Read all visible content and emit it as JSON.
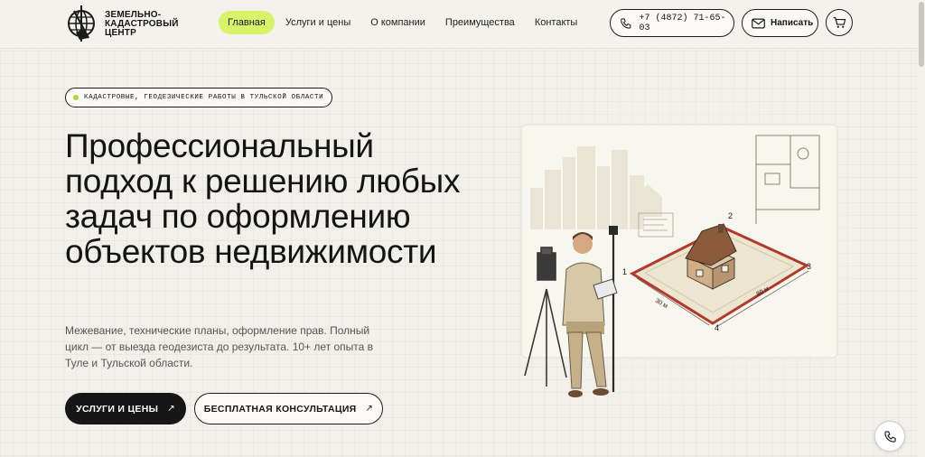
{
  "logo": {
    "lines": [
      "ЗЕМЕЛЬНО-",
      "КАДАСТРОВЫЙ",
      "ЦЕНТР"
    ]
  },
  "nav": [
    {
      "label": "Главная",
      "active": true
    },
    {
      "label": "Услуги и цены",
      "active": false
    },
    {
      "label": "О компании",
      "active": false
    },
    {
      "label": "Преимущества",
      "active": false
    },
    {
      "label": "Контакты",
      "active": false
    }
  ],
  "header": {
    "phone": "+7 (4872) 71-65-03",
    "write_label": "Написать",
    "icons": {
      "phone": "phone-icon",
      "write": "mail-icon",
      "cart": "cart-icon"
    }
  },
  "hero": {
    "badge": "КАДАСТРОВЫЕ, ГЕОДЕЗИЧЕСКИЕ РАБОТЫ В ТУЛЬСКОЙ ОБЛАСТИ",
    "title": "Профессиональный подход к решению любых задач по оформлению объектов недвижимости",
    "description": "Межевание, технические планы, оформление прав. Полный цикл — от выезда геодезиста до результата. 10+ лет опыта в Туле и Тульской области.",
    "primary_button": "УСЛУГИ И ЦЕНЫ",
    "secondary_button": "БЕСПЛАТНАЯ КОНСУЛЬТАЦИЯ",
    "button_arrow": "↗",
    "illustration_labels": {
      "p1": "1",
      "p2": "2",
      "p3": "3",
      "p4": "4",
      "d1": "30 м",
      "d2": "80 м"
    }
  },
  "colors": {
    "accent": "#d8f36a",
    "dark": "#161616",
    "background": "#f2f0ea",
    "plot_border": "#b23a2a"
  }
}
